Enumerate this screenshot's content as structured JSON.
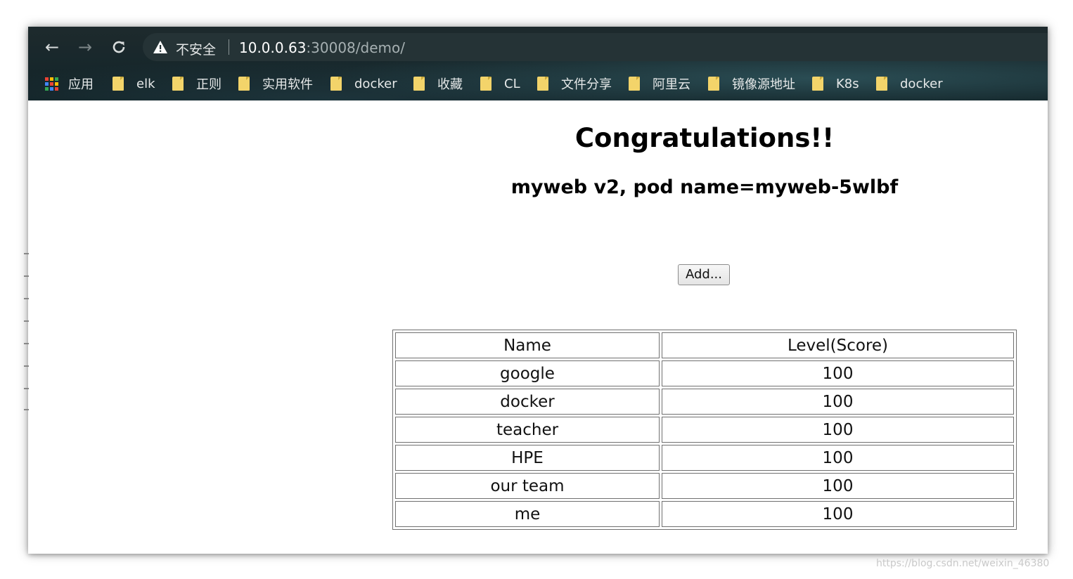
{
  "browser": {
    "security_label": "不安全",
    "url_host": "10.0.0.63",
    "url_rest": ":30008/demo/",
    "nav": {
      "back_icon": "arrow-left-icon",
      "forward_icon": "arrow-right-icon",
      "reload_icon": "reload-icon",
      "warning_icon": "warning-triangle-icon"
    },
    "bookmarks": [
      {
        "label": "应用",
        "icon": "apps-grid-icon"
      },
      {
        "label": "elk",
        "icon": "folder-icon"
      },
      {
        "label": "正则",
        "icon": "folder-icon"
      },
      {
        "label": "实用软件",
        "icon": "folder-icon"
      },
      {
        "label": "docker",
        "icon": "folder-icon"
      },
      {
        "label": "收藏",
        "icon": "folder-icon"
      },
      {
        "label": "CL",
        "icon": "folder-icon"
      },
      {
        "label": "文件分享",
        "icon": "folder-icon"
      },
      {
        "label": "阿里云",
        "icon": "folder-icon"
      },
      {
        "label": "镜像源地址",
        "icon": "folder-icon"
      },
      {
        "label": "K8s",
        "icon": "folder-icon"
      },
      {
        "label": "docker",
        "icon": "folder-icon"
      }
    ]
  },
  "page": {
    "title": "Congratulations!!",
    "subtitle": "myweb v2, pod name=myweb-5wlbf",
    "add_button": "Add...",
    "table": {
      "headers": [
        "Name",
        "Level(Score)"
      ],
      "rows": [
        [
          "google",
          "100"
        ],
        [
          "docker",
          "100"
        ],
        [
          "teacher",
          "100"
        ],
        [
          "HPE",
          "100"
        ],
        [
          "our team",
          "100"
        ],
        [
          "me",
          "100"
        ]
      ]
    }
  },
  "watermark": "https://blog.csdn.net/weixin_46380",
  "colors": {
    "chrome_bg": "#1e2a2d",
    "omnibox_bg": "#253336",
    "folder": "#f3d46a",
    "apps_grid": [
      "#ea4335",
      "#fbbc05",
      "#34a853",
      "#4285f4"
    ]
  }
}
